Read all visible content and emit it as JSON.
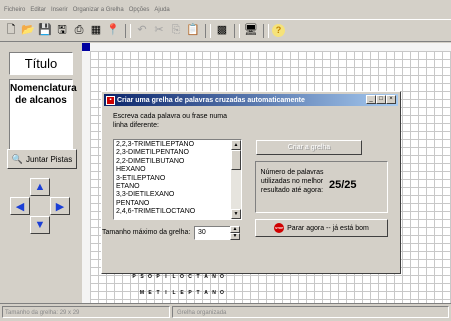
{
  "menu": [
    "Ficheiro",
    "Editar",
    "Inserir",
    "Organizar a Grelha",
    "Opções",
    "Ajuda"
  ],
  "toolbar": {
    "buttons": [
      {
        "name": "new-document-icon",
        "glyph": "🗋"
      },
      {
        "name": "open-folder-icon",
        "glyph": "📂"
      },
      {
        "name": "save-icon",
        "glyph": "💾"
      },
      {
        "name": "save-as-icon",
        "glyph": "🖫"
      },
      {
        "name": "print-icon",
        "glyph": "⎙"
      },
      {
        "name": "grid-icon",
        "glyph": "▦"
      },
      {
        "name": "pin-icon",
        "glyph": "📍"
      },
      {
        "name": "undo-icon",
        "glyph": "↶"
      },
      {
        "name": "cut-icon",
        "glyph": "✂"
      },
      {
        "name": "copy-icon",
        "glyph": "⎘"
      },
      {
        "name": "paste-icon",
        "glyph": "📋"
      },
      {
        "name": "fill-grid-icon",
        "glyph": "▩"
      },
      {
        "name": "monitor-icon",
        "glyph": "🖥"
      },
      {
        "name": "help-icon",
        "glyph": "?"
      }
    ]
  },
  "left": {
    "title": "Título",
    "clue_text": "Nomenclatura de alcanos",
    "join_clues": "Juntar Pistas",
    "arrows": {
      "up": "▲",
      "left": "◀",
      "right": "▶",
      "down": "▼"
    }
  },
  "dialog": {
    "title": "Criar uma grelha de palavras cruzadas automaticamente",
    "instruction": "Escreva cada palavra ou frase numa linha diferente:",
    "words": [
      "2,2,3-TRIMETILEPTANO",
      "2,3-DIMETILPENTANO",
      "2,2-DIMETILBUTANO",
      "HEXANO",
      "3-ETILEPTANO",
      "ETANO",
      "3,3-DIETILEXANO",
      "PENTANO",
      "2,4,6-TRIMETILOCTANO"
    ],
    "max_size_label": "Tamanho máximo da grelha:",
    "max_size_value": "30",
    "create_button": "Criar a grelha",
    "best_label": "Número de palavras utilizadas no melhor resultado até agora:",
    "best_value": "25/25",
    "stop_button": "Parar agora -- já está bom",
    "stop_icon_text": "STOP"
  },
  "grid_letters": {
    "row1": [
      "P",
      "S",
      "O",
      "P",
      "I",
      "L",
      "O",
      "C",
      "T",
      "A",
      "N",
      "O"
    ],
    "row2": [
      "M",
      "E",
      "T",
      "I",
      "L",
      "E",
      "P",
      "T",
      "A",
      "N",
      "O"
    ]
  },
  "status": {
    "left": "Tamanho da grelha: 29 x 29",
    "right": "Grelha organizada"
  }
}
